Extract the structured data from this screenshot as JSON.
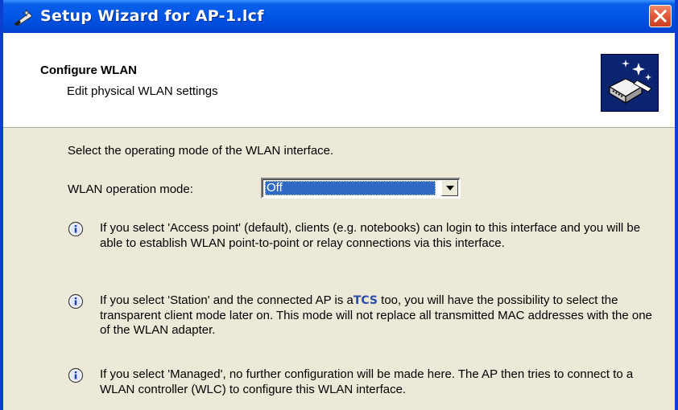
{
  "window": {
    "title": "Setup Wizard for AP-1.lcf",
    "icon": "wizard-wand-icon",
    "close_icon": "close-icon"
  },
  "header": {
    "title": "Configure WLAN",
    "subtitle": "Edit physical WLAN settings",
    "icon": "wlan-device-wizard-icon"
  },
  "content": {
    "intro": "Select the operating mode of the WLAN interface.",
    "mode_label": "WLAN operation mode:",
    "mode_value": "Off",
    "info": [
      {
        "icon": "info-icon",
        "text": "If you select 'Access point' (default), clients (e.g. notebooks) can login to this interface and you will be able to establish WLAN point-to-point or relay connections via this interface."
      },
      {
        "icon": "info-icon",
        "text_before": "If you select 'Station' and the connected AP is a",
        "brand": "TCS",
        "text_after": " too, you will have the possibility to select the transparent client mode later on. This mode will not replace all transmitted MAC addresses with the one of the WLAN adapter."
      },
      {
        "icon": "info-icon",
        "text": "If you select 'Managed', no further configuration will be made here. The AP then tries to connect to a WLAN controller (WLC) to configure this WLAN interface."
      }
    ]
  },
  "colors": {
    "titlebar": "#0055e5",
    "dialog_bg": "#ece9d8",
    "selection": "#316ac5",
    "close_button": "#e25a3a"
  }
}
